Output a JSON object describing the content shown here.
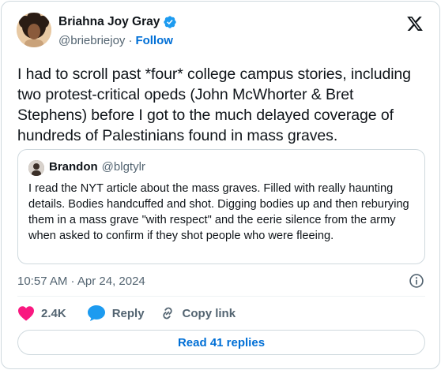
{
  "author": {
    "name": "Briahna Joy Gray",
    "handle": "@briebriejoy",
    "separator": "·",
    "follow_label": "Follow",
    "verified_color": "#1d9bf0"
  },
  "tweet": {
    "text": "I had to scroll past *four* college campus stories, including two protest-critical opeds (John McWhorter & Bret Stephens) before I got to the much delayed coverage of hundreds of Palestinians found in mass graves.",
    "timestamp": "10:57 AM · Apr 24, 2024"
  },
  "quote": {
    "name": "Brandon",
    "handle": "@blgtylr",
    "text": "I read the NYT article about the mass graves. Filled with really haunting details. Bodies handcuffed and shot. Digging bodies up and then reburying them in a mass grave \"with respect\" and the eerie silence from the army when asked to confirm if they shot people who were fleeing."
  },
  "actions": {
    "likes_count": "2.4K",
    "reply_label": "Reply",
    "copy_link_label": "Copy link",
    "like_color": "#f91880",
    "reply_color": "#1d9bf0"
  },
  "read_replies_label": "Read 41 replies",
  "icons": {
    "logo": "x-logo-icon",
    "info": "info-icon",
    "like": "heart-icon",
    "reply": "speech-bubble-icon",
    "copy": "link-icon",
    "verified": "verified-badge-icon"
  }
}
